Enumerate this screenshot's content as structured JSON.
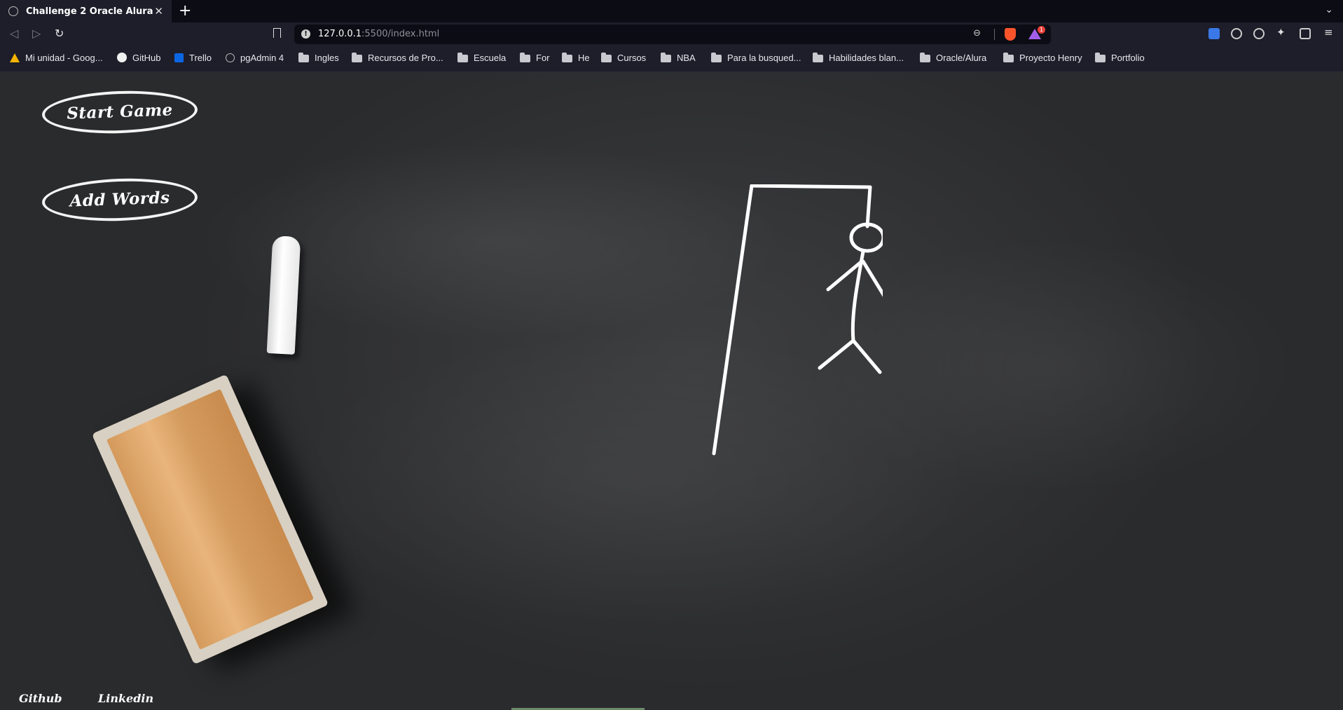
{
  "browser": {
    "tab_title": "Challenge 2 Oracle Alura",
    "tab_close": "✕",
    "new_tab": "+",
    "tab_menu": "⌄",
    "url_host": "127.0.0.1",
    "url_rest": ":5500/index.html",
    "rewards_count": "1",
    "bookmarks": [
      {
        "label": "Mi unidad - Goog...",
        "icon": "drive-icon"
      },
      {
        "label": "GitHub",
        "icon": "github-icon"
      },
      {
        "label": "Trello",
        "icon": "trello-icon"
      },
      {
        "label": "pgAdmin 4",
        "icon": "globe-icon"
      },
      {
        "label": "Ingles",
        "icon": "folder-icon"
      },
      {
        "label": "Recursos de Pro...",
        "icon": "folder-icon"
      },
      {
        "label": "Escuela",
        "icon": "folder-icon"
      },
      {
        "label": "For",
        "icon": "folder-icon"
      },
      {
        "label": "He",
        "icon": "folder-icon"
      },
      {
        "label": "Cursos",
        "icon": "folder-icon"
      },
      {
        "label": "NBA",
        "icon": "folder-icon"
      },
      {
        "label": "Para la busqued...",
        "icon": "folder-icon"
      },
      {
        "label": "Habilidades blan...",
        "icon": "folder-icon"
      },
      {
        "label": "Oracle/Alura",
        "icon": "folder-icon"
      },
      {
        "label": "Proyecto Henry",
        "icon": "folder-icon"
      },
      {
        "label": "Portfolio",
        "icon": "folder-icon"
      }
    ]
  },
  "page": {
    "start_button": "Start Game",
    "add_button": "Add Words",
    "footer": {
      "github": "Github",
      "linkedin": "Linkedin"
    }
  },
  "colors": {
    "board": "#2f3032",
    "chalk": "#ffffff",
    "chrome": "#1d1e2a"
  }
}
